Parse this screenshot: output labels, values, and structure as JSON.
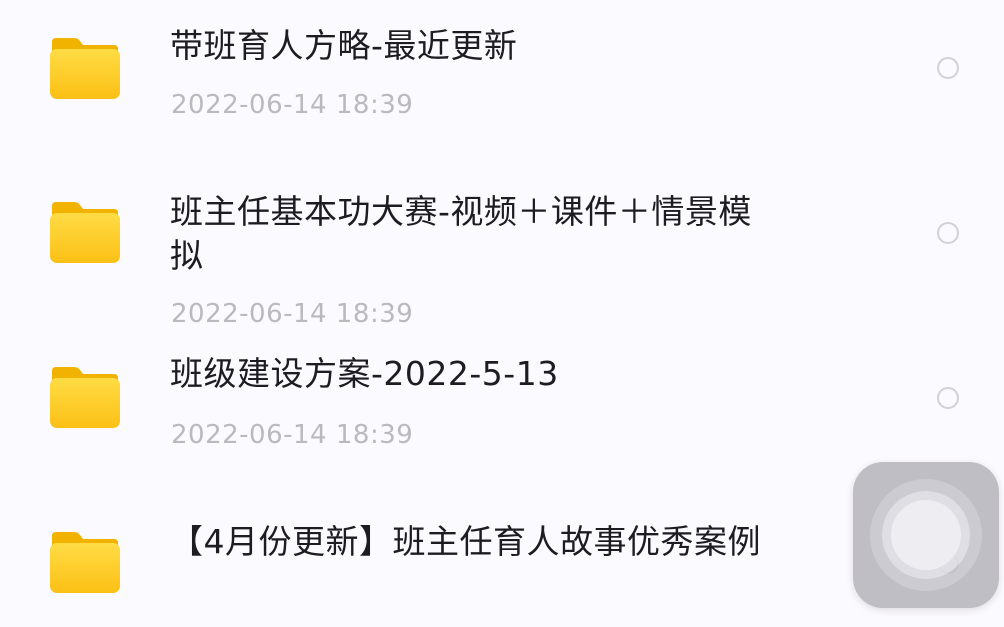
{
  "files": [
    {
      "name": "带班育人方略-最近更新",
      "date": "2022-06-14 18:39",
      "icon": "folder-icon"
    },
    {
      "name": "班主任基本功大赛-视频＋课件＋情景模拟",
      "date": "2022-06-14 18:39",
      "icon": "folder-icon"
    },
    {
      "name": "班级建设方案-2022-5-13",
      "date": "2022-06-14 18:39",
      "icon": "folder-icon"
    },
    {
      "name": "【4月份更新】班主任育人故事优秀案例",
      "date": "",
      "icon": "folder-icon"
    }
  ],
  "colors": {
    "folder_top": "#FFD93B",
    "folder_bottom": "#FBC21A",
    "folder_tab": "#F5B500",
    "text": "#1d1d1f",
    "meta": "#b9b9c0",
    "background": "#fbfafe"
  },
  "assistive_touch": {
    "icon": "assistive-touch-icon"
  }
}
